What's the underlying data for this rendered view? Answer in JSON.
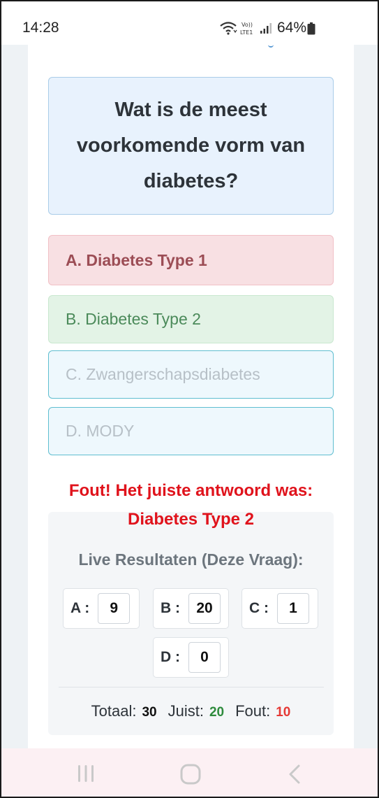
{
  "status_bar": {
    "time": "14:28",
    "network_label": "Vo))\nLTE1",
    "battery_percent": "64%"
  },
  "question": {
    "text": "Wat is de meest voorkomende vorm van diabetes?"
  },
  "options": [
    {
      "label": "A. Diabetes Type 1",
      "state": "wrong-selected"
    },
    {
      "label": "B. Diabetes Type 2",
      "state": "correct"
    },
    {
      "label": "C. Zwangerschapsdiabetes",
      "state": "disabled"
    },
    {
      "label": "D. MODY",
      "state": "disabled"
    }
  ],
  "feedback": {
    "line1": "Fout! Het juiste antwoord was:",
    "line2": "Diabetes Type 2"
  },
  "results": {
    "title": "Live Resultaten (Deze Vraag):",
    "stats": [
      {
        "label": "A :",
        "value": "9"
      },
      {
        "label": "B :",
        "value": "20"
      },
      {
        "label": "C :",
        "value": "1"
      },
      {
        "label": "D :",
        "value": "0"
      }
    ],
    "totals": {
      "total_label": "Totaal:",
      "total_value": "30",
      "correct_label": "Juist:",
      "correct_value": "20",
      "wrong_label": "Fout:",
      "wrong_value": "10"
    }
  },
  "colors": {
    "wrong": "#e0131c",
    "correct": "#2e8b3d",
    "accent_border": "#5fbed0",
    "question_bg": "#e8f2fd"
  },
  "icons": {
    "recent_apps": "recent-apps-icon",
    "home": "home-icon",
    "back": "back-icon",
    "wifi": "wifi-icon",
    "signal": "signal-icon",
    "battery": "battery-icon"
  }
}
